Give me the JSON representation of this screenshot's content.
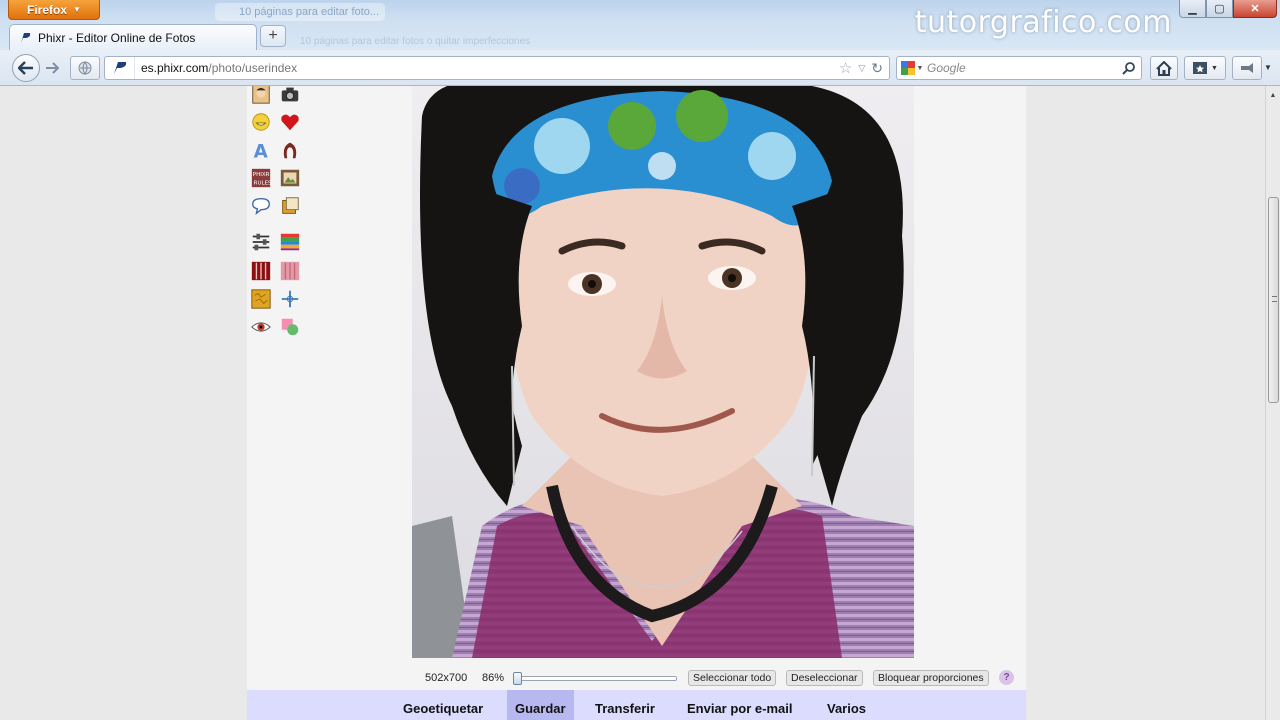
{
  "browser": {
    "app_button": "Firefox",
    "background_tab": "10 páginas para editar foto...",
    "background_tab2": "10 páginas para editar fotos o quitar imperfecciones",
    "watermark": "tutorgrafico.com",
    "tab": {
      "title": "Phixr - Editor Online de Fotos"
    },
    "new_tab": "+",
    "url": {
      "domain": "es.phixr.com",
      "path": "/photo/userindex"
    },
    "search": {
      "engine": "google-icon",
      "placeholder": "Google"
    }
  },
  "tools": [
    {
      "name": "face-tool-icon"
    },
    {
      "name": "camera-tool-icon"
    },
    {
      "name": "smiley-tool-icon"
    },
    {
      "name": "heart-tool-icon"
    },
    {
      "name": "text-tool-icon"
    },
    {
      "name": "hair-tool-icon"
    },
    {
      "name": "phixr-rules-tool-icon"
    },
    {
      "name": "picture-frame-tool-icon"
    },
    {
      "name": "speech-bubble-tool-icon"
    },
    {
      "name": "layers-tool-icon"
    },
    {
      "name": "adjust-sliders-tool-icon"
    },
    {
      "name": "color-stripes-tool-icon"
    },
    {
      "name": "bars-filter-tool-icon"
    },
    {
      "name": "pink-bars-filter-tool-icon"
    },
    {
      "name": "texture-tool-icon"
    },
    {
      "name": "crosshair-tool-icon"
    },
    {
      "name": "red-eye-tool-icon"
    },
    {
      "name": "shapes-tool-icon"
    }
  ],
  "editor": {
    "dimensions": "502x700",
    "zoom": "86%",
    "zoom_level": 0,
    "select_all": "Seleccionar todo",
    "deselect": "Deseleccionar",
    "lock_proportions": "Bloquear proporciones",
    "help": "?"
  },
  "menu": [
    {
      "label": "Geoetiquetar",
      "active": false
    },
    {
      "label": "Guardar",
      "active": true
    },
    {
      "label": "Transferir",
      "active": false
    },
    {
      "label": "Enviar por e-mail",
      "active": false
    },
    {
      "label": "Varios",
      "active": false
    }
  ],
  "colors": {
    "accent": "#e0700d",
    "menu_bar": "#dcdcff",
    "menu_active": "#b8b8f0"
  }
}
